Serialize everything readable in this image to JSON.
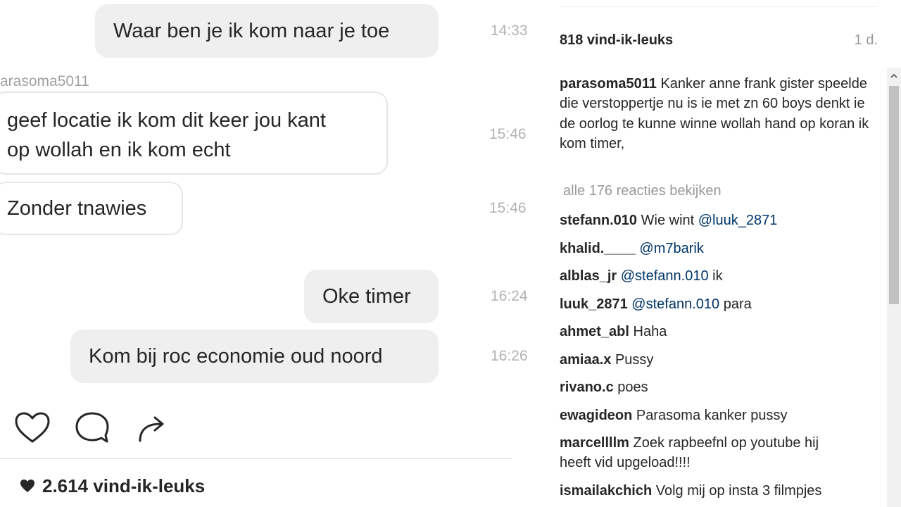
{
  "chat": {
    "messages": [
      {
        "direction": "outgoing",
        "text": "Waar ben je ik kom naar je toe",
        "time": "14:33"
      },
      {
        "direction": "incoming",
        "sender": "parasoma5011",
        "lines": [
          "geef locatie ik kom dit keer jou kant",
          "op wollah en ik kom echt"
        ],
        "time": "15:46"
      },
      {
        "direction": "incoming",
        "text": "Zonder tnawies",
        "time": "15:46"
      },
      {
        "direction": "outgoing",
        "text": "Oke timer",
        "time": "16:24"
      },
      {
        "direction": "outgoing",
        "text": "Kom bij roc economie oud noord",
        "time": "16:26"
      }
    ],
    "sender_label": "arasoma5011",
    "actions": [
      "heart-icon",
      "comment-icon",
      "share-icon"
    ],
    "likes": "2.614 vind-ik-leuks"
  },
  "post": {
    "likes": "818 vind-ik-leuks",
    "age": "1 d.",
    "caption": {
      "username": "parasoma5011",
      "text": "Kanker anne frank gister speelde die verstoppertje nu is ie met zn 60 boys denkt ie de oorlog te kunne winne wollah hand op koran ik kom timer,"
    },
    "view_all": "alle 176 reacties bekijken",
    "comments": [
      {
        "username": "stefann.010",
        "text": "Wie wint ",
        "mention": "@luuk_2871"
      },
      {
        "username": "khalid.____",
        "text": " ",
        "mention": "@m7barik"
      },
      {
        "username": "alblas_jr",
        "mention": "@stefann.010",
        "after": " ik"
      },
      {
        "username": "luuk_2871",
        "mention": "@stefann.010",
        "after": " para"
      },
      {
        "username": "ahmet_abl",
        "text": "Haha"
      },
      {
        "username": "amiaa.x",
        "text": "Pussy"
      },
      {
        "username": "rivano.c",
        "text": "poes"
      },
      {
        "username": "ewagideon",
        "text": "Parasoma kanker pussy"
      },
      {
        "username": "marcellllm",
        "text": "Zoek rapbeefnl op youtube hij heeft vid upgeload!!!!"
      },
      {
        "username": "ismailakchich",
        "text": "Volg mij op insta 3 filmpjes"
      }
    ]
  },
  "colors": {
    "outgoing_bubble": "#efefef",
    "mention": "#003569",
    "muted": "#999999"
  }
}
